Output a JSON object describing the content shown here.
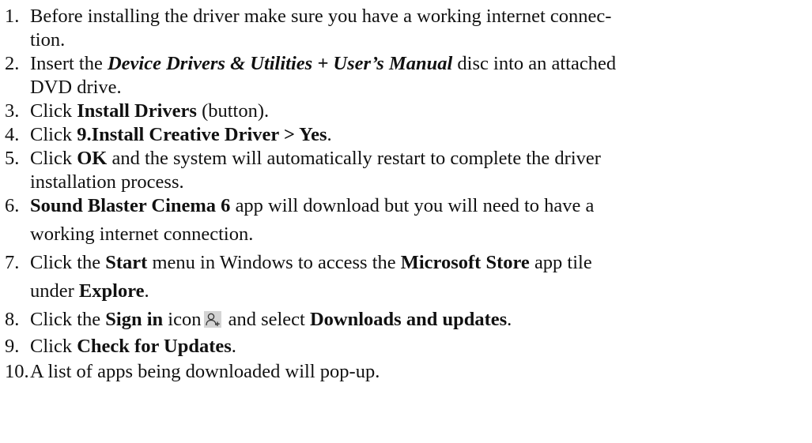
{
  "steps": [
    {
      "num": "1.",
      "lines": [
        "Before installing the driver make sure you have a working internet connec-",
        "tion."
      ]
    },
    {
      "num": "2.",
      "pre": "Insert the ",
      "em": "Device Drivers & Utilities + User’s Manual",
      "post": " disc into an attached",
      "line2": "DVD drive."
    },
    {
      "num": "3.",
      "pre": "Click ",
      "bold": "Install Drivers",
      "post": " (button)."
    },
    {
      "num": "4.",
      "pre": "Click ",
      "bold": "9.Install Creative Driver > Yes",
      "post": "."
    },
    {
      "num": "5.",
      "pre": "Click ",
      "bold": "OK",
      "post": " and the system will automatically restart to complete the driver",
      "line2": "installation process."
    },
    {
      "num": "6.",
      "bold": "Sound Blaster Cinema 6",
      "post": " app will download but you will need to have a",
      "line2": "working internet connection."
    },
    {
      "num": "7.",
      "pre": "Click the ",
      "bold1": "Start",
      "mid": " menu in Windows to access the ",
      "bold2": "Microsoft Store",
      "post": " app tile",
      "line2_pre": "under ",
      "line2_bold": "Explore",
      "line2_post": "."
    },
    {
      "num": "8.",
      "pre": "Click the ",
      "bold1": "Sign in",
      "mid": " icon",
      "mid2": " and select ",
      "bold2": "Downloads and updates",
      "post": ".",
      "icon": "person-add-icon"
    },
    {
      "num": "9.",
      "pre": "Click ",
      "bold": "Check for Updates",
      "post": "."
    },
    {
      "num": "10.",
      "text": "A list of apps being downloaded will pop-up."
    }
  ]
}
